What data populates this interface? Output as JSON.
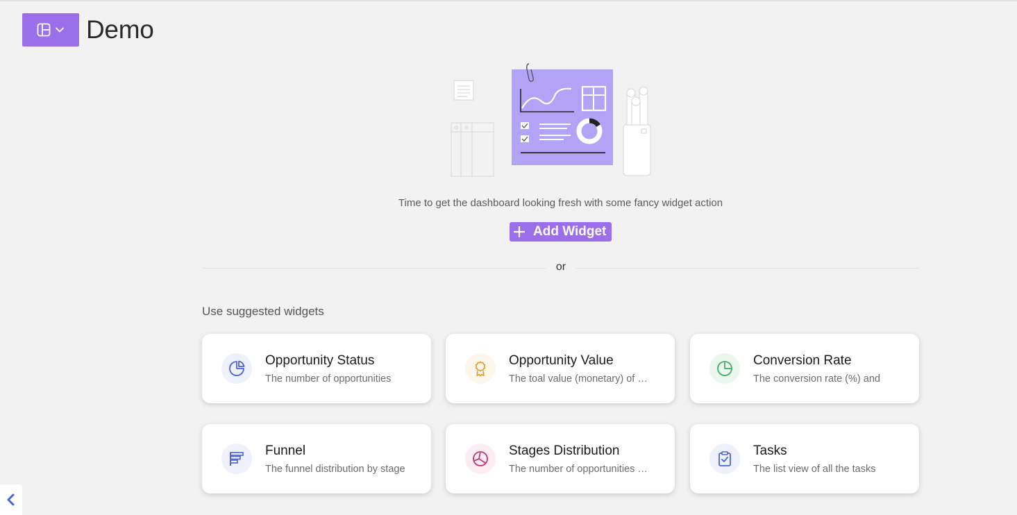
{
  "page": {
    "title": "Demo"
  },
  "empty_state": {
    "tagline": "Time to get the dashboard looking fresh with some fancy widget action",
    "add_button_label": "Add Widget",
    "or_label": "or"
  },
  "suggested": {
    "heading": "Use suggested widgets",
    "cards": [
      {
        "title": "Opportunity Status",
        "description": "The number of opportunities",
        "icon": "pie-chart-icon",
        "color": "#4a63d9",
        "bg": "#eef0fb"
      },
      {
        "title": "Opportunity Value",
        "description": "The toal value (monetary) of opportunities",
        "icon": "award-icon",
        "color": "#e39a2a",
        "bg": "#fdf6ea"
      },
      {
        "title": "Conversion Rate",
        "description": "The conversion rate (%) and",
        "icon": "pie-chart-icon",
        "color": "#3fae63",
        "bg": "#eaf6ee"
      },
      {
        "title": "Funnel",
        "description": "The funnel distribution by stage",
        "icon": "funnel-icon",
        "color": "#4a63d9",
        "bg": "#eef0fb"
      },
      {
        "title": "Stages Distribution",
        "description": "The number of opportunities per stage",
        "icon": "distribution-icon",
        "color": "#c4367a",
        "bg": "#fbedf3"
      },
      {
        "title": "Tasks",
        "description": "The list view of all the tasks",
        "icon": "clipboard-check-icon",
        "color": "#4a63d9",
        "bg": "#eef0fb"
      }
    ]
  },
  "colors": {
    "accent": "#9b6fe9",
    "background": "#f2f2f2"
  }
}
